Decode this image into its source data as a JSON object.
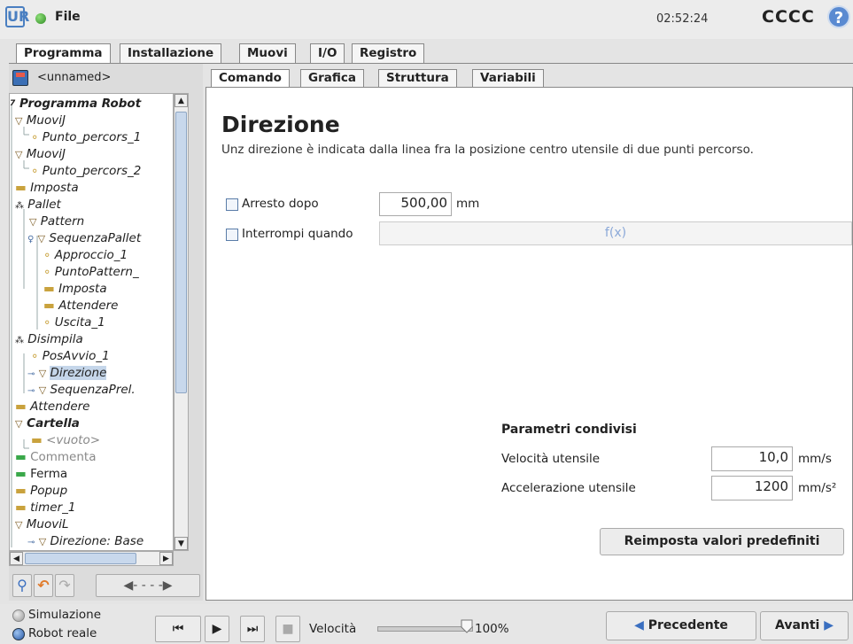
{
  "topbar": {
    "file_label": "File",
    "clock": "02:52:24",
    "robot_name": "CCCC",
    "help": "?"
  },
  "main_tabs": [
    "Programma",
    "Installazione",
    "Muovi",
    "I/O",
    "Registro"
  ],
  "program": {
    "name": "<unnamed>"
  },
  "tree": [
    {
      "label": "Programma Robot"
    },
    {
      "label": "MuoviJ"
    },
    {
      "label": "Punto_percors_1"
    },
    {
      "label": "MuoviJ"
    },
    {
      "label": "Punto_percors_2"
    },
    {
      "label": "Imposta"
    },
    {
      "label": "Pallet"
    },
    {
      "label": "Pattern"
    },
    {
      "label": "SequenzaPallet"
    },
    {
      "label": "Approccio_1"
    },
    {
      "label": "PuntoPattern_"
    },
    {
      "label": "Imposta"
    },
    {
      "label": "Attendere"
    },
    {
      "label": "Uscita_1"
    },
    {
      "label": "Disimpila"
    },
    {
      "label": "PosAvvio_1"
    },
    {
      "label": "Direzione"
    },
    {
      "label": "SequenzaPrel."
    },
    {
      "label": "Attendere"
    },
    {
      "label": "Cartella"
    },
    {
      "label": "<vuoto>"
    },
    {
      "label": "Commenta"
    },
    {
      "label": "Ferma"
    },
    {
      "label": "Popup"
    },
    {
      "label": "timer_1"
    },
    {
      "label": "MuoviL"
    },
    {
      "label": "Direzione: Base"
    }
  ],
  "sub_tabs": [
    "Comando",
    "Grafica",
    "Struttura",
    "Variabili"
  ],
  "command": {
    "title": "Direzione",
    "description": "Unz direzione è indicata dalla linea fra la posizione centro utensile di due punti percorso.",
    "stop_after_label": "Arresto dopo",
    "stop_after_value": "500,00",
    "stop_after_unit": "mm",
    "interrupt_label": "Interrompi quando",
    "interrupt_value": "f(x)"
  },
  "shared": {
    "heading": "Parametri condivisi",
    "speed_label": "Velocità utensile",
    "speed_value": "10,0",
    "speed_unit": "mm/s",
    "accel_label": "Accelerazione utensile",
    "accel_value": "1200",
    "accel_unit": "mm/s²",
    "reset_label": "Reimposta valori predefiniti"
  },
  "bottom": {
    "sim_label": "Simulazione",
    "real_label": "Robot reale",
    "speed_label": "Velocità",
    "speed_value": "100%",
    "speed_fraction": 1.0,
    "prev_label": "Precedente",
    "next_label": "Avanti"
  }
}
